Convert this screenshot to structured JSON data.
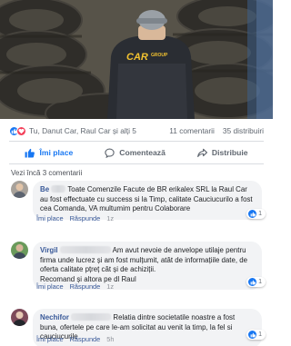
{
  "photo": {
    "jacket_logo": "CAR",
    "jacket_logo_sub": "GROUP"
  },
  "reactions": {
    "names": "Tu, Danut Car, Raul Car și alți 5",
    "comments_count": "11 comentarii",
    "shares_count": "35 distribuiri",
    "like_icon": "thumbs-up-icon",
    "love_icon": "heart-icon"
  },
  "actions": {
    "like_label": "Îmi place",
    "comment_label": "Comentează",
    "share_label": "Distribuie"
  },
  "previous_comments": "Vezi încă 3 comentarii",
  "comments": [
    {
      "author": "Be",
      "text": "Toate Comenzile Facute de BR erikalex SRL la Raul Car au fost effectuate cu success si la Timp, calitate Cauciucurilo a fost cea Comanda, VA multumim pentru Colaborare",
      "like_label": "Îmi place",
      "reply_label": "Răspunde",
      "time": "1z",
      "reaction_count": "1"
    },
    {
      "author": "Virgil",
      "text": "Am avut nevoie de anvelope utilaje pentru firma unde lucrez și am fost mulțumit, atât de informațiile date, de oferta calitate pțreț cât și de achiziții.",
      "text2": "Recomand și altora pe dl Raul",
      "like_label": "Îmi place",
      "reply_label": "Răspunde",
      "time": "1z",
      "reaction_count": "1"
    },
    {
      "author": "Nechifor",
      "text": "Relatia dintre societatile noastre a fost buna, ofertele pe care le-am solicitat au venit la timp, la fel si cauciucurile",
      "like_label": "Îmi place",
      "reply_label": "Răspunde",
      "time": "5h",
      "reaction_count": "1"
    }
  ],
  "colors": {
    "facebook_blue": "#1877f2",
    "link_blue": "#385898",
    "bubble_gray": "#f2f3f5",
    "meta_gray": "#90949c"
  }
}
